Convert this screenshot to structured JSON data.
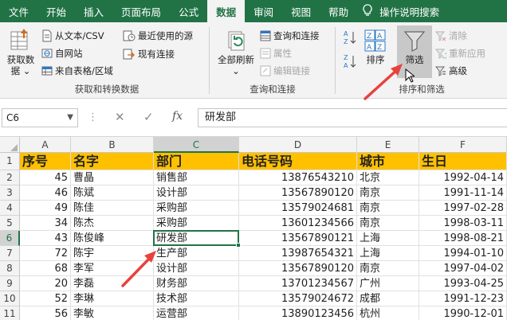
{
  "tabs": [
    {
      "label": "文件",
      "active": false
    },
    {
      "label": "开始",
      "active": false
    },
    {
      "label": "插入",
      "active": false
    },
    {
      "label": "页面布局",
      "active": false
    },
    {
      "label": "公式",
      "active": false
    },
    {
      "label": "数据",
      "active": true
    },
    {
      "label": "审阅",
      "active": false
    },
    {
      "label": "视图",
      "active": false
    },
    {
      "label": "帮助",
      "active": false
    }
  ],
  "tell_me": "操作说明搜索",
  "ribbon": {
    "get_data_label_1": "获取数",
    "get_data_label_2": "据",
    "from_text_csv": "从文本/CSV",
    "from_web": "自网站",
    "from_table": "来自表格/区域",
    "recent_sources": "最近使用的源",
    "existing_connections": "现有连接",
    "group_get_transform": "获取和转换数据",
    "refresh_all": "全部刷新",
    "queries_connections": "查询和连接",
    "properties": "属性",
    "edit_links": "编辑链接",
    "group_queries": "查询和连接",
    "sort": "排序",
    "filter": "筛选",
    "clear": "清除",
    "reapply": "重新应用",
    "advanced": "高级",
    "group_sort_filter": "排序和筛选"
  },
  "formula_bar": {
    "name_box": "C6",
    "content": "研发部"
  },
  "columns": [
    "A",
    "B",
    "C",
    "D",
    "E",
    "F"
  ],
  "selected": {
    "col": "C",
    "row": 6
  },
  "rows": [
    {
      "n": "1",
      "cells": [
        "序号",
        "名字",
        "部门",
        "电话号码",
        "城市",
        "生日"
      ]
    },
    {
      "n": "2",
      "cells": [
        "45",
        "曹晶",
        "销售部",
        "13876543210",
        "北京",
        "1992-04-14"
      ]
    },
    {
      "n": "3",
      "cells": [
        "46",
        "陈斌",
        "设计部",
        "13567890120",
        "南京",
        "1991-11-14"
      ]
    },
    {
      "n": "4",
      "cells": [
        "49",
        "陈佳",
        "采购部",
        "13579024681",
        "南京",
        "1997-02-28"
      ]
    },
    {
      "n": "5",
      "cells": [
        "34",
        "陈杰",
        "采购部",
        "13601234566",
        "南京",
        "1998-03-11"
      ]
    },
    {
      "n": "6",
      "cells": [
        "43",
        "陈俊峰",
        "研发部",
        "13567890121",
        "上海",
        "1998-08-21"
      ]
    },
    {
      "n": "7",
      "cells": [
        "72",
        "陈宇",
        "生产部",
        "13987654321",
        "上海",
        "1994-01-10"
      ]
    },
    {
      "n": "8",
      "cells": [
        "68",
        "李军",
        "设计部",
        "13567890120",
        "南京",
        "1997-04-02"
      ]
    },
    {
      "n": "9",
      "cells": [
        "20",
        "李磊",
        "财务部",
        "13701234567",
        "广州",
        "1993-04-25"
      ]
    },
    {
      "n": "10",
      "cells": [
        "52",
        "李琳",
        "技术部",
        "13579024672",
        "成都",
        "1991-12-23"
      ]
    },
    {
      "n": "11",
      "cells": [
        "56",
        "李敏",
        "运营部",
        "13890123456",
        "杭州",
        "1990-12-01"
      ]
    }
  ],
  "colors": {
    "brand": "#217346",
    "header_fill": "#ffc000",
    "arrow": "#e8423c"
  },
  "icons": [
    "lightbulb-icon",
    "database-icon",
    "text-file-icon",
    "web-icon",
    "table-icon",
    "clock-icon",
    "connection-icon",
    "refresh-icon",
    "sort-az-icon",
    "sort-za-icon",
    "sort-icon",
    "funnel-icon",
    "clear-filter-icon",
    "reapply-icon",
    "advanced-filter-icon",
    "cursor-icon",
    "fx-icon"
  ]
}
